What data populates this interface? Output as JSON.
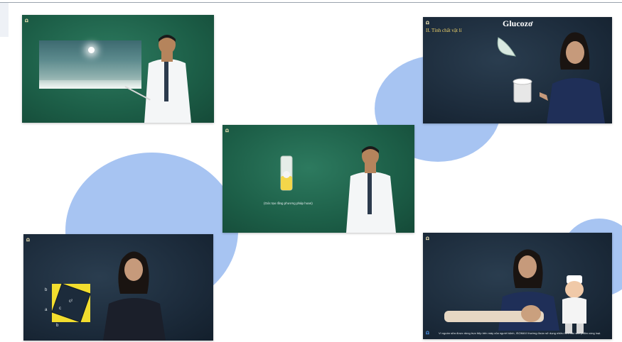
{
  "page": {
    "background": "#ffffff",
    "accent_circle_color": "#a7c4f2"
  },
  "videos": [
    {
      "id": "v1",
      "board": "green",
      "logo": "ꭥ",
      "caption": ""
    },
    {
      "id": "v2",
      "board": "navy",
      "logo": "ꭥ",
      "title": "Glucozơ",
      "subtitle": "II. Tính chất vật lí"
    },
    {
      "id": "v3",
      "board": "green",
      "logo": "ꭥ",
      "caption": "(Góc tạo rằng phương pháp hoan)"
    },
    {
      "id": "v4",
      "board": "navy",
      "logo": "ꭥ",
      "labels": [
        "b",
        "a",
        "b",
        "c",
        "c²"
      ]
    },
    {
      "id": "v5",
      "board": "navy",
      "logo": "ꭥ",
      "caption": "Vì nguồn sữa được dùng trực tiếp trên máy của người bệnh, ISOMAX thường được sử dụng nhiều hơn các sản phẩm cùng loại."
    }
  ]
}
